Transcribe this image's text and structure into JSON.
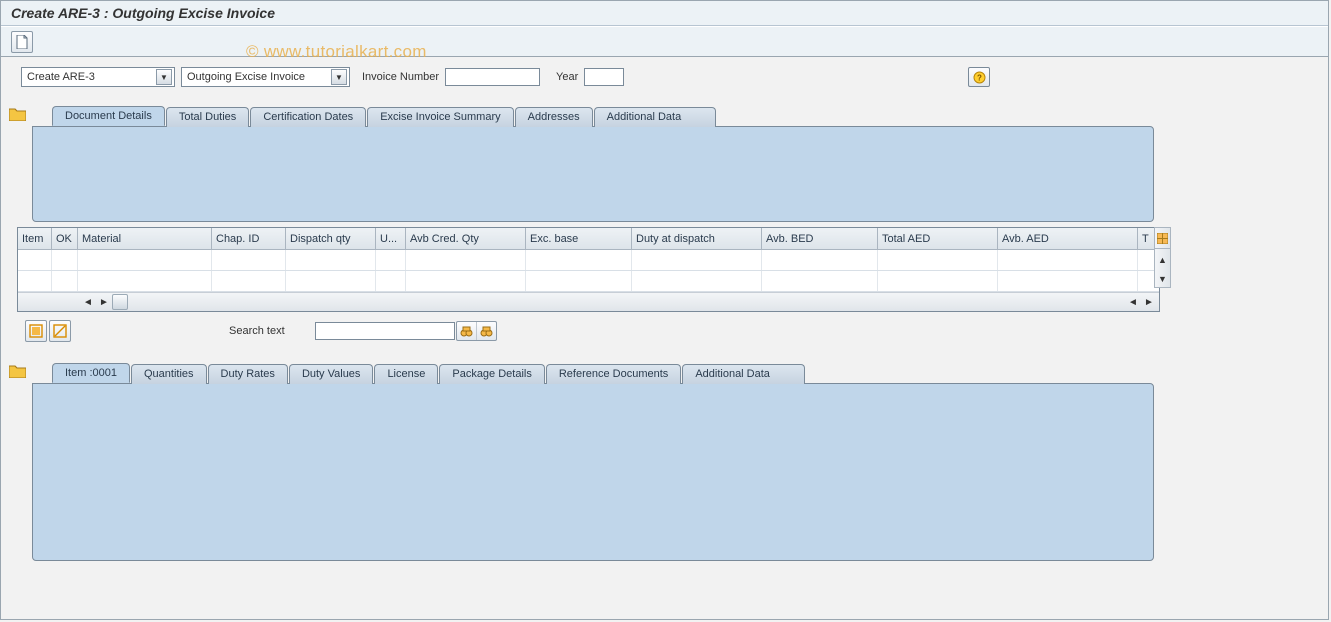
{
  "title": "Create ARE-3 : Outgoing Excise Invoice",
  "watermark": "© www.tutorialkart.com",
  "toolbar": {
    "new_doc": "New document"
  },
  "selection": {
    "dd1": "Create ARE-3",
    "dd2": "Outgoing Excise Invoice",
    "invoice_label": "Invoice Number",
    "invoice_value": "",
    "year_label": "Year",
    "year_value": ""
  },
  "upper_tabs": [
    "Document Details",
    "Total Duties",
    "Certification Dates",
    "Excise Invoice Summary",
    "Addresses",
    "Additional Data"
  ],
  "grid": {
    "columns": [
      "Item",
      "OK",
      "Material",
      "Chap. ID",
      "Dispatch qty",
      "U...",
      "Avb Cred. Qty",
      "Exc. base",
      "Duty at dispatch",
      "Avb. BED",
      "Total AED",
      "Avb. AED",
      "T"
    ],
    "rows": [
      [],
      []
    ]
  },
  "search": {
    "label": "Search text",
    "value": ""
  },
  "lower_tabs": [
    "Item  :0001",
    "Quantities",
    "Duty Rates",
    "Duty Values",
    "License",
    "Package Details",
    "Reference Documents",
    "Additional Data"
  ]
}
